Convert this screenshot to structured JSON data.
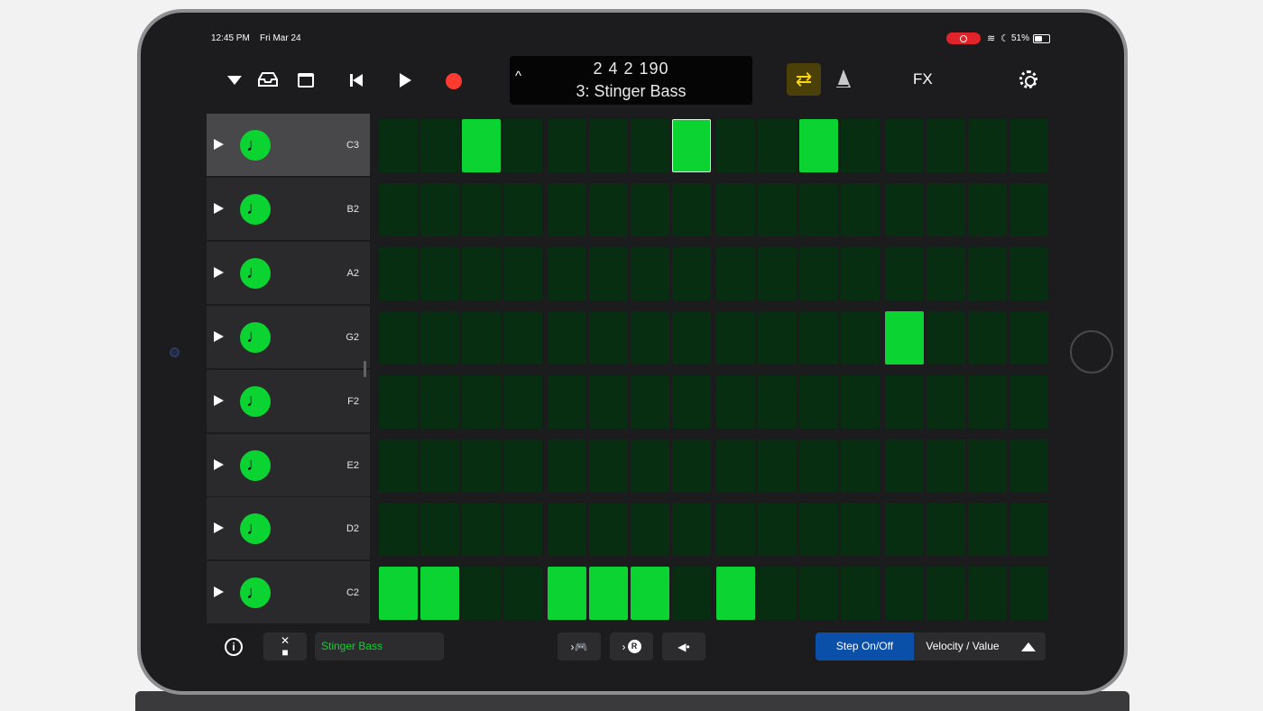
{
  "status_bar": {
    "time": "12:45 PM",
    "date": "Fri Mar 24",
    "battery_text": "51%",
    "battery_level": 0.51
  },
  "toolbar": {
    "lcd_chevron": "^",
    "lcd_position": "2 4 2 190",
    "lcd_track": "3: Stinger Bass",
    "fx_label": "FX"
  },
  "tracks": [
    {
      "label": "C3",
      "steps": [
        0,
        0,
        1,
        0,
        0,
        0,
        0,
        1,
        0,
        0,
        1,
        0,
        0,
        0,
        0,
        0
      ],
      "selected": true
    },
    {
      "label": "B2",
      "steps": [
        0,
        0,
        0,
        0,
        0,
        0,
        0,
        0,
        0,
        0,
        0,
        0,
        0,
        0,
        0,
        0
      ],
      "selected": false
    },
    {
      "label": "A2",
      "steps": [
        0,
        0,
        0,
        0,
        0,
        0,
        0,
        0,
        0,
        0,
        0,
        0,
        0,
        0,
        0,
        0
      ],
      "selected": false
    },
    {
      "label": "G2",
      "steps": [
        0,
        0,
        0,
        0,
        0,
        0,
        0,
        0,
        0,
        0,
        0,
        0,
        1,
        0,
        0,
        0
      ],
      "selected": false
    },
    {
      "label": "F2",
      "steps": [
        0,
        0,
        0,
        0,
        0,
        0,
        0,
        0,
        0,
        0,
        0,
        0,
        0,
        0,
        0,
        0
      ],
      "selected": false
    },
    {
      "label": "E2",
      "steps": [
        0,
        0,
        0,
        0,
        0,
        0,
        0,
        0,
        0,
        0,
        0,
        0,
        0,
        0,
        0,
        0
      ],
      "selected": false
    },
    {
      "label": "D2",
      "steps": [
        0,
        0,
        0,
        0,
        0,
        0,
        0,
        0,
        0,
        0,
        0,
        0,
        0,
        0,
        0,
        0
      ],
      "selected": false
    },
    {
      "label": "C2",
      "steps": [
        1,
        1,
        0,
        0,
        1,
        1,
        1,
        0,
        1,
        0,
        0,
        0,
        0,
        0,
        0,
        0
      ],
      "selected": false
    }
  ],
  "playhead_step": 7,
  "icons": {
    "track_note": "♩",
    "cycle": "⇄",
    "delete_x": "✕",
    "delete_square": "■",
    "gamepad": "›🎮",
    "record_mode": "›",
    "record_badge": "R",
    "speaker": "◀•",
    "info": "i"
  },
  "bottom_bar": {
    "track_name": "Stinger Bass",
    "step_on_off": "Step On/Off",
    "velocity_value": "Velocity / Value"
  },
  "colors": {
    "step_on": "#0bd332",
    "step_off": "#072e10",
    "record": "#ff3b30",
    "cycle_active": "#ffd60a",
    "segment_active": "#0a4fa8"
  }
}
